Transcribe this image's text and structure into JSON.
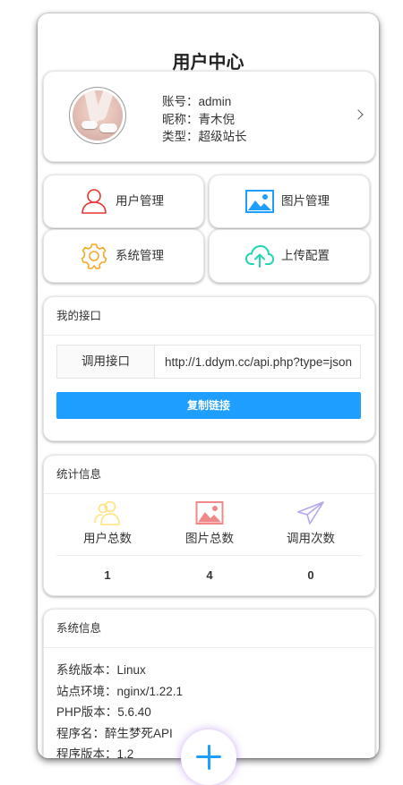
{
  "header": {
    "title": "用户中心"
  },
  "profile": {
    "account": "账号：admin",
    "nickname": "昵称：青木倪",
    "type": "类型：超级站长"
  },
  "menu": {
    "items": [
      {
        "label": "用户管理",
        "icon": "user-icon",
        "color": "#e8352e"
      },
      {
        "label": "图片管理",
        "icon": "image-icon",
        "color": "#1e9fff"
      },
      {
        "label": "系统管理",
        "icon": "gear-icon",
        "color": "#f7a928"
      },
      {
        "label": "上传配置",
        "icon": "cloud-upload-icon",
        "color": "#1ed6b0"
      }
    ]
  },
  "api": {
    "section_title": "我的接口",
    "label": "调用接口",
    "url": "http://1.ddym.cc/api.php?type=json",
    "copy_label": "复制链接"
  },
  "stats": {
    "section_title": "统计信息",
    "items": [
      {
        "label": "用户总数",
        "value": "1",
        "icon": "users-icon",
        "color": "#ffe27a"
      },
      {
        "label": "图片总数",
        "value": "4",
        "icon": "image-icon",
        "color": "#f08a8a"
      },
      {
        "label": "调用次数",
        "value": "0",
        "icon": "paper-plane-icon",
        "color": "#b7a6f2"
      }
    ]
  },
  "system": {
    "section_title": "系统信息",
    "lines": [
      "系统版本：Linux",
      "站点环境：nginx/1.22.1",
      "PHP版本：5.6.40",
      "程序名：醉生梦死API",
      "程序版本：1.2"
    ]
  },
  "fab": {
    "icon": "plus-icon",
    "color": "#1e9fff"
  },
  "colors": {
    "accent": "#1e9fff"
  }
}
